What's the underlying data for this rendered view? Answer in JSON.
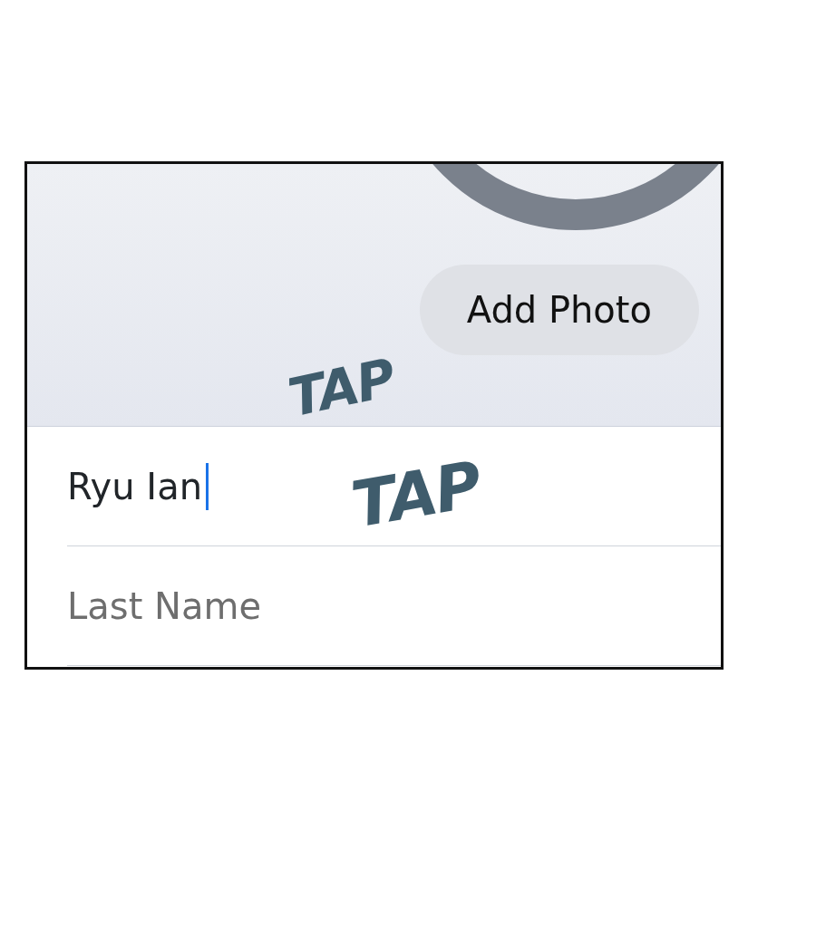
{
  "add_photo_button": {
    "label": "Add Photo"
  },
  "fields": [
    {
      "value": "Ryu Ian",
      "focused": true
    },
    {
      "placeholder": "Last Name",
      "focused": false
    }
  ],
  "sound_effects": [
    "TAP",
    "TAP"
  ]
}
